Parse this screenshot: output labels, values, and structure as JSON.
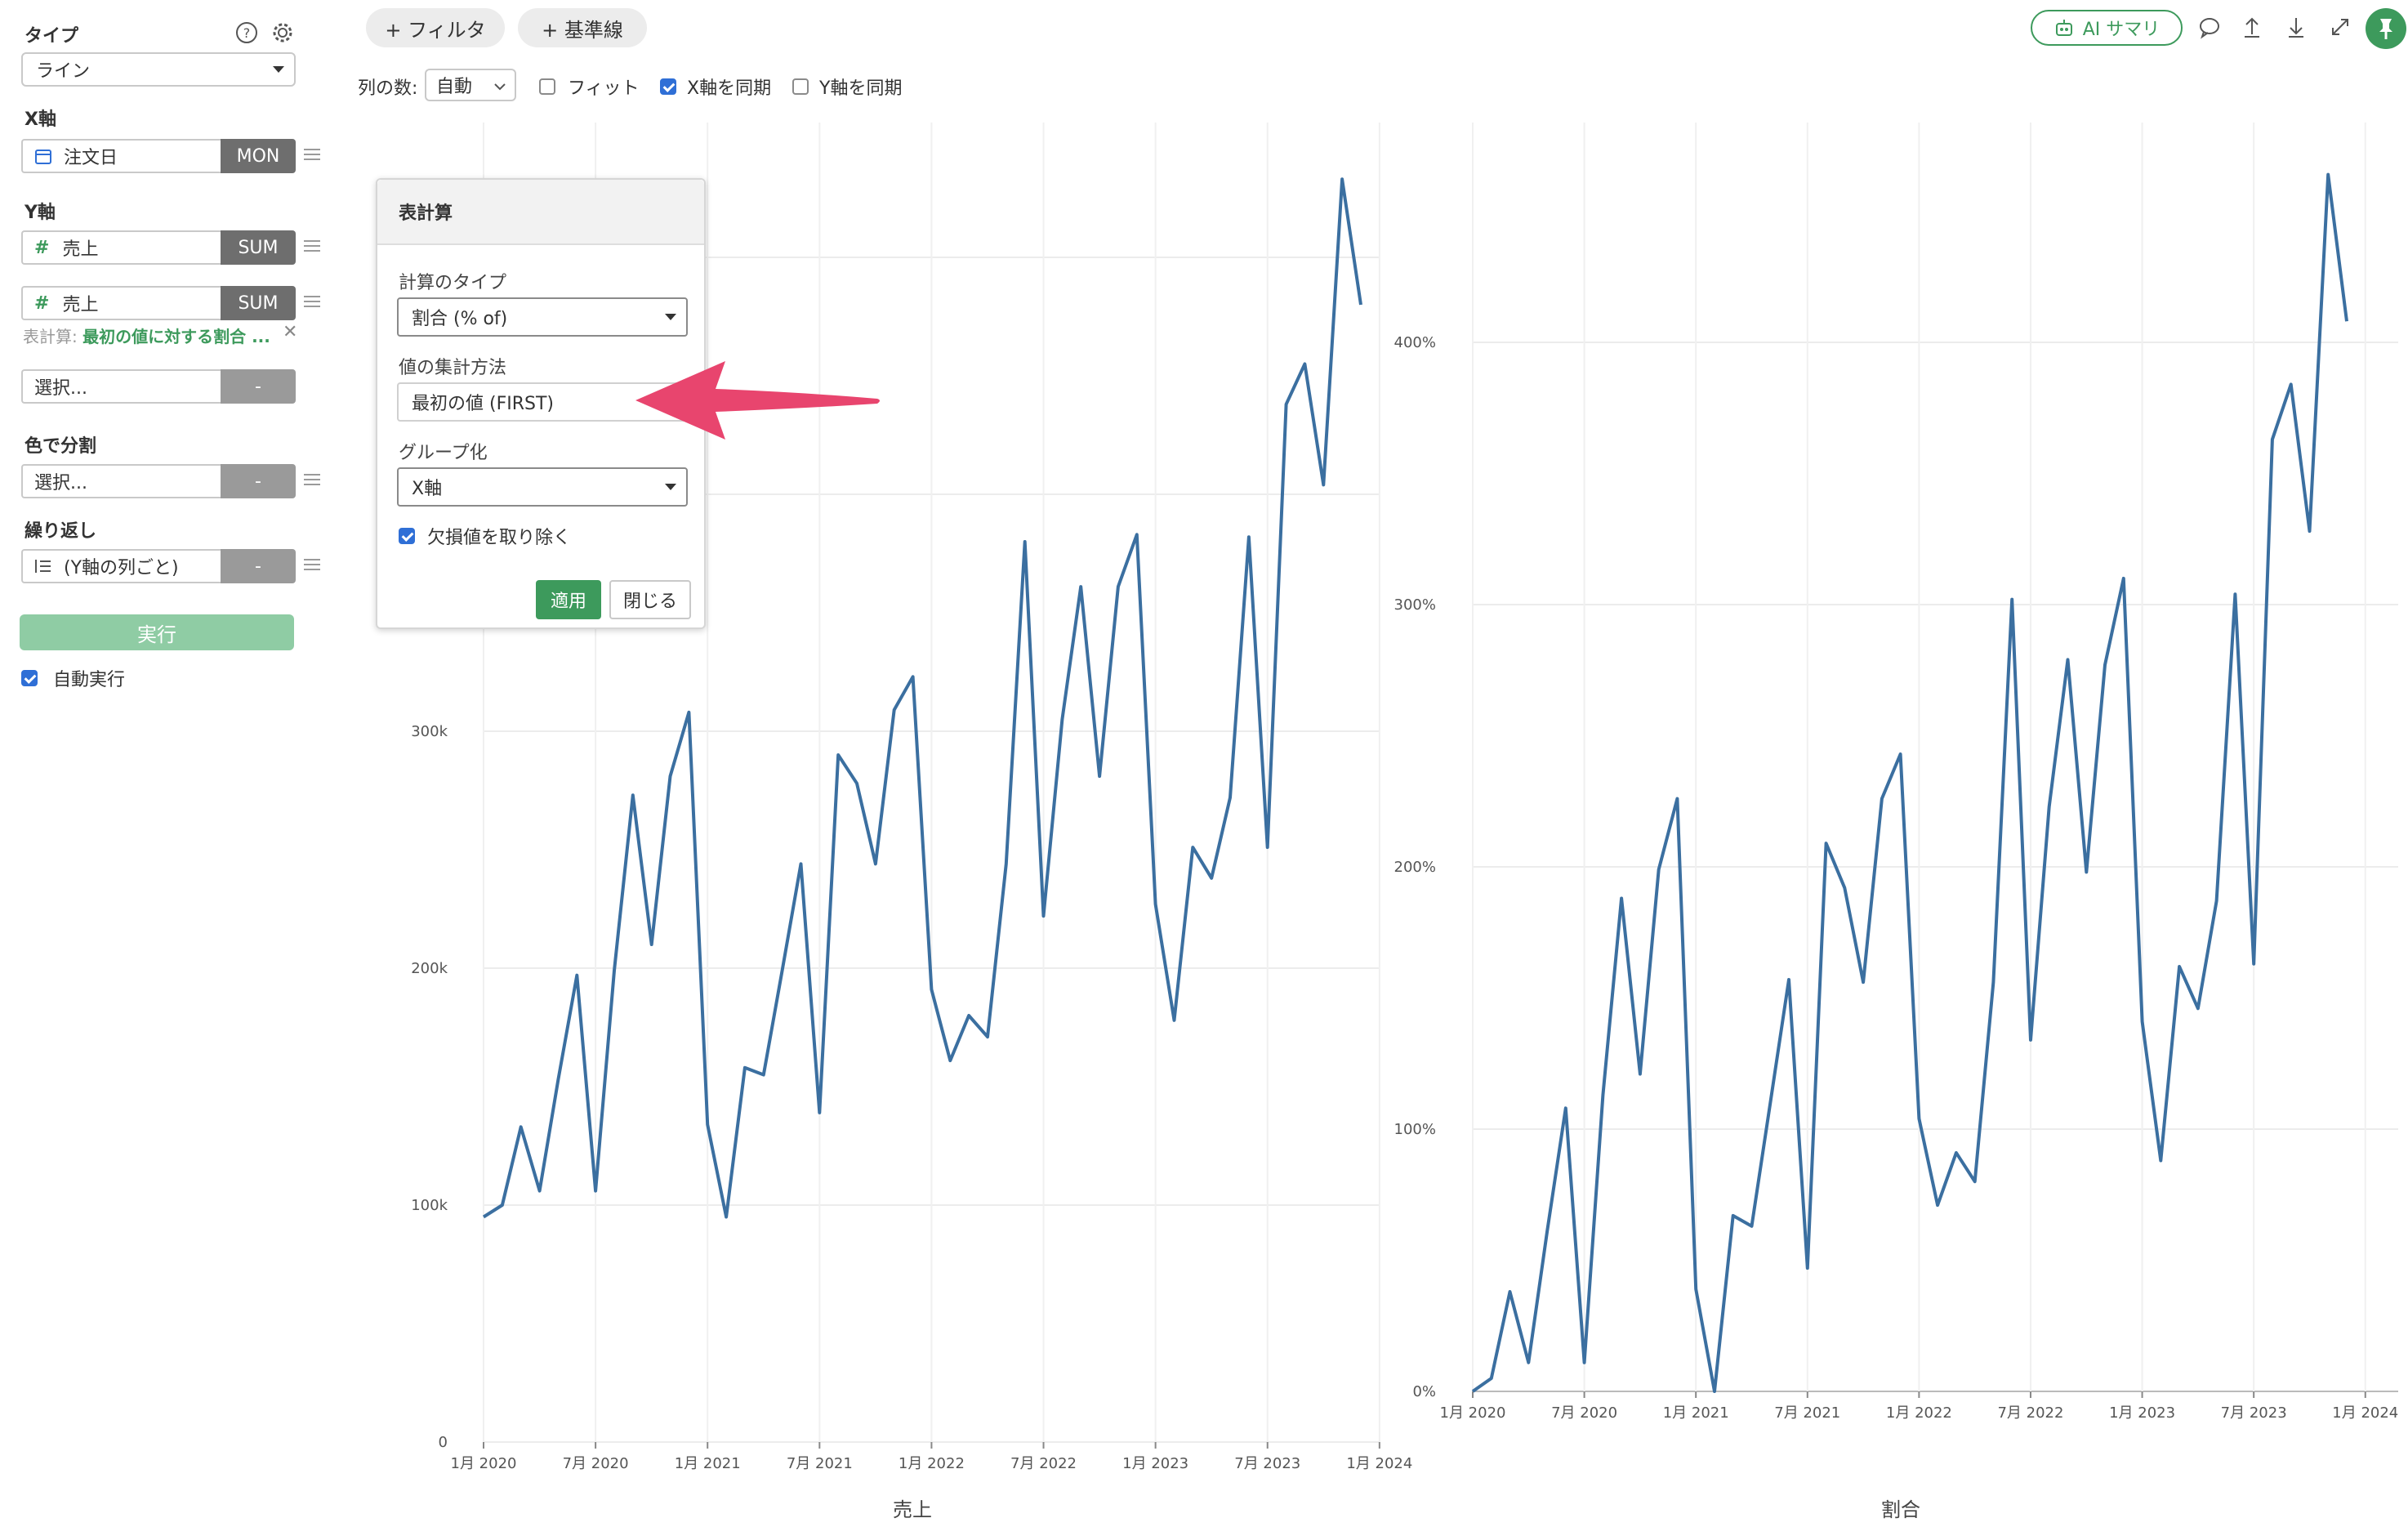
{
  "left_panel": {
    "type_title": "タイプ",
    "type_value": "ライン",
    "x_axis_title": "X軸",
    "x_field": "注文日",
    "x_agg": "MON",
    "y_axis_title": "Y軸",
    "y_field_1": "売上",
    "y_agg_1": "SUM",
    "y_field_2": "売上",
    "y_agg_2": "SUM",
    "table_calc_prefix": "表計算:",
    "table_calc_value": "最初の値に対する割合 ...",
    "y_select_placeholder": "選択...",
    "y_select_agg": "-",
    "color_title": "色で分割",
    "color_select_placeholder": "選択...",
    "color_select_agg": "-",
    "repeat_title": "繰り返し",
    "repeat_field": "(Y軸の列ごと)",
    "repeat_agg": "-",
    "run_label": "実行",
    "auto_run_label": "自動実行"
  },
  "toolbar": {
    "filter_label": "+ フィルタ",
    "baseline_label": "+ 基準線",
    "ai_summary_label": "AI サマリ"
  },
  "options": {
    "columns_label": "列の数:",
    "columns_value": "自動",
    "fit_label": "フィット",
    "sync_x_label": "X軸を同期",
    "sync_y_label": "Y軸を同期"
  },
  "popup": {
    "title": "表計算",
    "calc_type_label": "計算のタイプ",
    "calc_type_value": "割合 (% of)",
    "agg_method_label": "値の集計方法",
    "agg_method_value": "最初の値 (FIRST)",
    "group_label": "グループ化",
    "group_value": "X軸",
    "remove_missing_label": "欠損値を取り除く",
    "apply_label": "適用",
    "close_label": "閉じる"
  },
  "colors": {
    "accent": "#3d9a5c",
    "line": "#3b6fa0",
    "arrow": "#e8456e"
  },
  "chart_data": [
    {
      "type": "line",
      "xlabel": "売上",
      "ylabel": "",
      "ylim": [
        0,
        490000
      ],
      "y_ticks": [
        "0",
        "100k",
        "200k",
        "300k"
      ],
      "x_ticks": [
        "1月 2020",
        "7月 2020",
        "1月 2021",
        "7月 2021",
        "1月 2022",
        "7月 2022",
        "1月 2023",
        "7月 2023",
        "1月 2024"
      ],
      "values": [
        95000,
        100000,
        133000,
        106000,
        153000,
        197000,
        106000,
        199000,
        273000,
        210000,
        281000,
        308000,
        134000,
        95000,
        158000,
        155000,
        199000,
        244000,
        139000,
        290000,
        278000,
        244000,
        309000,
        323000,
        191000,
        161000,
        180000,
        171000,
        244000,
        380000,
        222000,
        305000,
        361000,
        281000,
        361000,
        383000,
        227000,
        178000,
        251000,
        238000,
        272000,
        382000,
        251000,
        438000,
        455000,
        404000,
        533000,
        480000
      ]
    },
    {
      "type": "line",
      "xlabel": "割合",
      "ylabel": "",
      "ylim": [
        0,
        4.64
      ],
      "y_ticks": [
        "0%",
        "100%",
        "200%",
        "300%",
        "400%"
      ],
      "x_ticks": [
        "1月 2020",
        "7月 2020",
        "1月 2021",
        "7月 2021",
        "1月 2022",
        "7月 2022",
        "1月 2023",
        "7月 2023",
        "1月 2024"
      ],
      "values": [
        0,
        0.05,
        0.38,
        0.11,
        0.61,
        1.08,
        0.11,
        1.13,
        1.88,
        1.21,
        1.99,
        2.26,
        0.39,
        0,
        0.67,
        0.63,
        1.1,
        1.57,
        0.47,
        2.09,
        1.92,
        1.56,
        2.26,
        2.43,
        1.04,
        0.71,
        0.91,
        0.8,
        1.56,
        3.02,
        1.34,
        2.23,
        2.79,
        1.98,
        2.77,
        3.1,
        1.41,
        0.88,
        1.62,
        1.46,
        1.87,
        3.04,
        1.63,
        3.63,
        3.84,
        3.28,
        4.64,
        4.08
      ]
    }
  ]
}
